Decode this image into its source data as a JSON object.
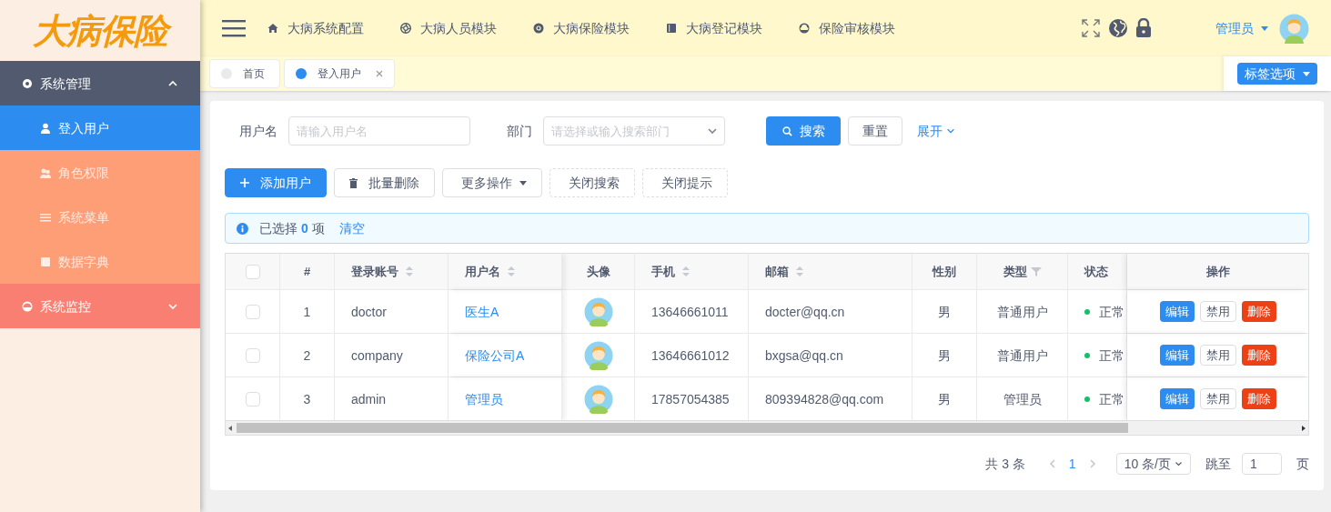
{
  "logo": {
    "text": "大病保险"
  },
  "sidebar": {
    "groups": [
      {
        "label": "系统管理",
        "expanded": true,
        "children": [
          {
            "label": "登入用户",
            "selected": true
          },
          {
            "label": "角色权限",
            "selected": false
          },
          {
            "label": "系统菜单",
            "selected": false
          },
          {
            "label": "数据字典",
            "selected": false
          }
        ]
      },
      {
        "label": "系统监控",
        "expanded": false
      }
    ]
  },
  "header": {
    "modules": [
      {
        "label": "大病系统配置"
      },
      {
        "label": "大病人员模块"
      },
      {
        "label": "大病保险模块"
      },
      {
        "label": "大病登记模块"
      },
      {
        "label": "保险审核模块"
      }
    ],
    "user": "管理员"
  },
  "tabs": [
    {
      "label": "首页",
      "selected": false
    },
    {
      "label": "登入用户",
      "selected": true
    }
  ],
  "tab_options": "标签选项",
  "search": {
    "fields": [
      {
        "label": "用户名",
        "placeholder": "请输入用户名",
        "kind": "input"
      },
      {
        "label": "部门",
        "placeholder": "请选择或输入搜索部门",
        "kind": "select"
      }
    ],
    "search_button": "搜索",
    "reset_button": "重置",
    "expand_link": "展开"
  },
  "toolbar": [
    {
      "label": "添加用户",
      "kind": "primary"
    },
    {
      "label": "批量删除",
      "kind": "default"
    },
    {
      "label": "更多操作",
      "kind": "dropdown"
    },
    {
      "label": "关闭搜索",
      "kind": "dashed"
    },
    {
      "label": "关闭提示",
      "kind": "dashed"
    }
  ],
  "alert": {
    "prefix": "已选择",
    "count": "0",
    "suffix": "项",
    "clear": "清空"
  },
  "table": {
    "all_checked": false,
    "columns": [
      {
        "title": "#",
        "sortable": false,
        "filter": false
      },
      {
        "title": "登录账号",
        "sortable": true,
        "filter": false
      },
      {
        "title": "用户名",
        "sortable": true,
        "filter": false
      },
      {
        "title": "头像",
        "sortable": false,
        "filter": false
      },
      {
        "title": "手机",
        "sortable": true,
        "filter": false
      },
      {
        "title": "邮箱",
        "sortable": true,
        "filter": false
      },
      {
        "title": "性别",
        "sortable": false,
        "filter": false
      },
      {
        "title": "类型",
        "sortable": false,
        "filter": true
      },
      {
        "title": "状态",
        "sortable": false,
        "filter": false
      },
      {
        "title": "操作",
        "sortable": false,
        "filter": false
      }
    ],
    "rows": [
      {
        "checked": false,
        "index": "1",
        "account": "doctor",
        "username": "医生A",
        "phone": "13646661011",
        "email": "docter@qq.cn",
        "gender": "男",
        "type": "普通用户",
        "status": "正常",
        "color": "#19be6b",
        "actions": [
          "编辑",
          "禁用",
          "删除"
        ]
      },
      {
        "checked": false,
        "index": "2",
        "account": "company",
        "username": "保险公司A",
        "phone": "13646661012",
        "email": "bxgsa@qq.cn",
        "gender": "男",
        "type": "普通用户",
        "status": "正常",
        "color": "#19be6b",
        "actions": [
          "编辑",
          "禁用",
          "删除"
        ]
      },
      {
        "checked": false,
        "index": "3",
        "account": "admin",
        "username": "管理员",
        "phone": "17857054385",
        "email": "809394828@qq.com",
        "gender": "男",
        "type": "管理员",
        "status": "正常",
        "color": "#19be6b",
        "actions": [
          "编辑",
          "禁用",
          "删除"
        ]
      }
    ]
  },
  "pagination": {
    "total": "共 3 条",
    "page": "1",
    "page_size": "10 条/页",
    "jump_label": "跳至",
    "jump_value": "1",
    "page_suffix": "页"
  }
}
